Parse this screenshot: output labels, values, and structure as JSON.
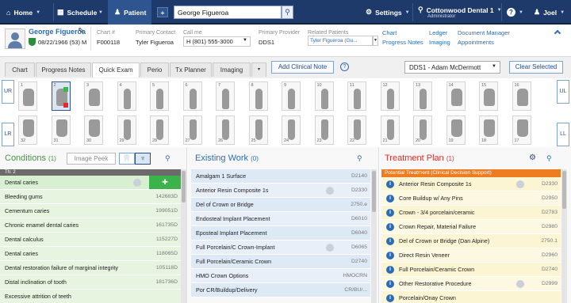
{
  "nav": {
    "home": "Home",
    "schedule": "Schedule",
    "patient": "Patient",
    "add": "+",
    "search_value": "George Figueroa",
    "settings": "Settings",
    "location": "Cottonwood Dental 1",
    "location_sub": "Administrator",
    "help": "?",
    "user": "Joel"
  },
  "patient": {
    "name": "George Figueroa",
    "dob": "08/22/1966 (53) M",
    "chart_label": "Chart #",
    "chart_value": "F000118",
    "contact_label": "Primary Contact",
    "contact_value": "Tyler Figueroa",
    "call_label": "Call me",
    "call_value": "H (801) 555-3000",
    "provider_label": "Primary Provider",
    "provider_value": "DDS1",
    "related_label": "Related Patients",
    "related_value": "Tyler Figueroa (Gu...",
    "links_col1": [
      "Chart",
      "Progress Notes"
    ],
    "links_col2": [
      "Ledger",
      "Imaging"
    ],
    "links_col3": [
      "Document Manager",
      "Appointments"
    ]
  },
  "tabs": {
    "items": [
      "Chart",
      "Progress Notes",
      "Quick Exam",
      "Perio",
      "Tx Planner",
      "Imaging"
    ],
    "active": "Quick Exam",
    "more": "▾",
    "add_note": "Add Clinical Note",
    "help": "?",
    "provider_select": "DDS1 - Adam McDermott",
    "clear_selected": "Clear Selected"
  },
  "teeth": {
    "upper_left_label": "UR",
    "upper_right_label": "UL",
    "lower_left_label": "LR",
    "lower_right_label": "LL",
    "upper": [
      "1",
      "2",
      "3",
      "4",
      "5",
      "6",
      "7",
      "8",
      "9",
      "10",
      "11",
      "12",
      "13",
      "14",
      "15",
      "16"
    ],
    "lower": [
      "32",
      "31",
      "30",
      "29",
      "28",
      "27",
      "26",
      "25",
      "24",
      "23",
      "22",
      "21",
      "20",
      "19",
      "18",
      "17"
    ]
  },
  "conditions": {
    "title": "Conditions",
    "count": "(1)",
    "image_peek": "Image Peek",
    "header_row": "Th: 2",
    "rows": [
      {
        "label": "Dental caries",
        "code": ""
      },
      {
        "label": "Bleeding gums",
        "code": "142683D"
      },
      {
        "label": "Cementum caries",
        "code": "199051D"
      },
      {
        "label": "Chronic enamel dental caries",
        "code": "161735D"
      },
      {
        "label": "Dental calculus",
        "code": "115227D"
      },
      {
        "label": "Dental caries",
        "code": "118065D"
      },
      {
        "label": "Dental restoration failure of marginal integrity",
        "code": "105118D"
      },
      {
        "label": "Distal inclination of tooth",
        "code": "181736D"
      },
      {
        "label": "Excessive attrition of teeth",
        "code": ""
      }
    ]
  },
  "existing": {
    "title": "Existing Work",
    "count": "(0)",
    "rows": [
      {
        "label": "Amalgam 1 Surface",
        "code": "D2140"
      },
      {
        "label": "Anterior Resin Composite 1s",
        "code": "D2330"
      },
      {
        "label": "Del of Crown or Bridge",
        "code": "2750.e"
      },
      {
        "label": "Endosteal Implant Placement",
        "code": "D6010"
      },
      {
        "label": "Eposteal Implant Placement",
        "code": "D6040"
      },
      {
        "label": "Full Porcelain/C Crown-Implant",
        "code": "D6065"
      },
      {
        "label": "Full Porcelain/Ceramic Crown",
        "code": "D2740"
      },
      {
        "label": "HMO Crown Options",
        "code": "HMOCRN"
      },
      {
        "label": "Por CR/Buildup/Delivery",
        "code": "CR/BU/..."
      }
    ]
  },
  "treatment": {
    "title": "Treatment Plan",
    "count": "(1)",
    "banner": "Potential Treatment (Clinical Decision Support)",
    "rows": [
      {
        "label": "Anterior Resin Composite 1s",
        "code": "D2330"
      },
      {
        "label": "Core Buildup w/ Any Pins",
        "code": "D2950"
      },
      {
        "label": "Crown - 3/4 porcelain/ceramic",
        "code": "D2783"
      },
      {
        "label": "Crown Repair, Material Failure",
        "code": "D2980"
      },
      {
        "label": "Del of Crown or Bridge (Dan Alpine)",
        "code": "2750.1"
      },
      {
        "label": "Direct Resin Veneer",
        "code": "D2960"
      },
      {
        "label": "Full Porcelain/Ceramic Crown",
        "code": "D2740"
      },
      {
        "label": "Other Restorative Procedure",
        "code": "D2999"
      },
      {
        "label": "Porcelain/Onay Crown",
        "code": ""
      }
    ]
  },
  "colors": {
    "nav_bg": "#1e3a6a",
    "link": "#2b6cb8",
    "conditions_green": "#3b9a3b",
    "treatment_red": "#d9312b",
    "banner_orange": "#ee7d22",
    "row_green": "#e3f3dd",
    "row_blue": "#dde9f5",
    "row_yellow": "#fbf7d8"
  }
}
